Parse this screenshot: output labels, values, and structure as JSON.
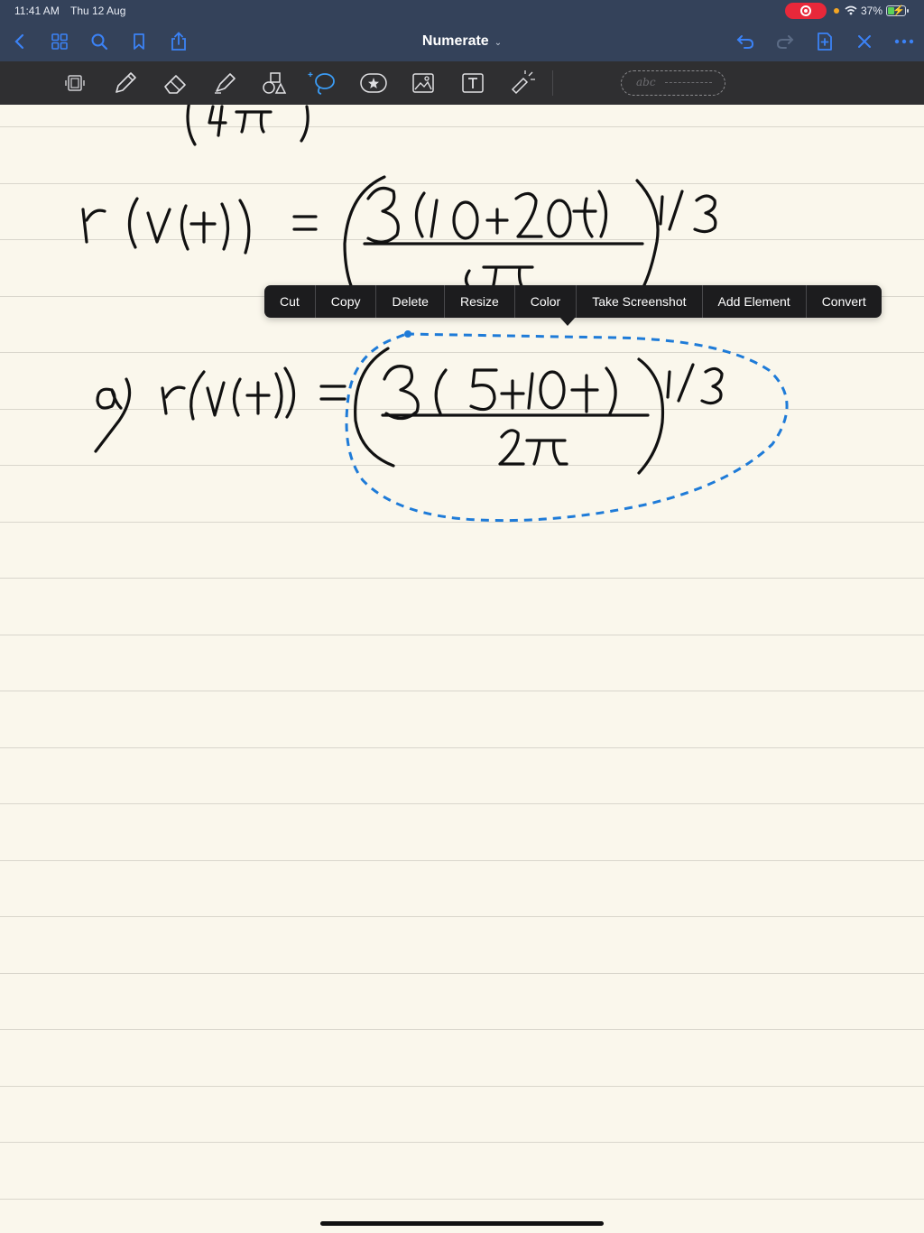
{
  "status_bar": {
    "time": "11:41 AM",
    "date": "Thu 12 Aug",
    "battery_percent": "37%",
    "battery_level": 0.37
  },
  "nav_bar": {
    "title": "Numerate",
    "icons": [
      "chevron-left-icon",
      "grid-icon",
      "search-icon",
      "bookmark-icon",
      "share-icon",
      "undo-icon",
      "redo-icon",
      "add-page-icon",
      "close-icon",
      "more-icon"
    ]
  },
  "toolbar": {
    "tools": [
      "page-tool-icon",
      "pen-icon",
      "eraser-icon",
      "highlighter-icon",
      "shapes-icon",
      "lasso-icon",
      "sticker-icon",
      "image-icon",
      "text-box-icon",
      "laser-pointer-icon"
    ],
    "sample_text": "abc"
  },
  "context_menu": {
    "items": [
      "Cut",
      "Copy",
      "Delete",
      "Resize",
      "Color",
      "Take Screenshot",
      "Add Element",
      "Convert"
    ]
  },
  "colors": {
    "chrome": "#34425a",
    "toolbar": "#2f2f31",
    "paper": "#faf7ec",
    "accent": "#3b82f6",
    "selection": "#1e7bd8",
    "ink": "#111111"
  }
}
